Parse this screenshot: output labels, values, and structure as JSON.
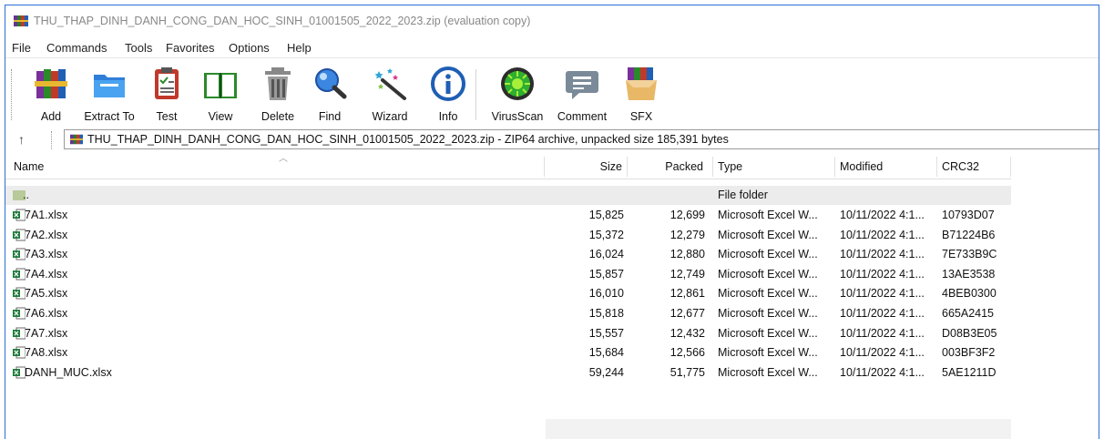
{
  "window": {
    "title": "THU_THAP_DINH_DANH_CONG_DAN_HOC_SINH_01001505_2022_2023.zip (evaluation copy)",
    "app_icon": "winrar-books-icon"
  },
  "menu": [
    "File",
    "Commands",
    "Tools",
    "Favorites",
    "Options",
    "Help"
  ],
  "toolbar": [
    {
      "label": "Add",
      "icon": "add-archive-icon"
    },
    {
      "label": "Extract To",
      "icon": "extract-folder-icon"
    },
    {
      "label": "Test",
      "icon": "test-clipboard-icon"
    },
    {
      "label": "View",
      "icon": "view-book-icon"
    },
    {
      "label": "Delete",
      "icon": "delete-trash-icon"
    },
    {
      "label": "Find",
      "icon": "find-magnifier-icon"
    },
    {
      "label": "Wizard",
      "icon": "wizard-wand-icon"
    },
    {
      "label": "Info",
      "icon": "info-icon"
    },
    {
      "label": "VirusScan",
      "icon": "virus-scan-icon"
    },
    {
      "label": "Comment",
      "icon": "comment-icon"
    },
    {
      "label": "SFX",
      "icon": "sfx-box-icon"
    }
  ],
  "address": {
    "text": "THU_THAP_DINH_DANH_CONG_DAN_HOC_SINH_01001505_2022_2023.zip - ZIP64 archive, unpacked size 185,391 bytes"
  },
  "columns": {
    "name": "Name",
    "size": "Size",
    "packed": "Packed",
    "type": "Type",
    "modified": "Modified",
    "crc": "CRC32"
  },
  "parent_row": {
    "name": "..",
    "type": "File folder"
  },
  "files": [
    {
      "name": "7A1.xlsx",
      "size": "15,825",
      "packed": "12,699",
      "type": "Microsoft Excel W...",
      "modified": "10/11/2022 4:1...",
      "crc": "10793D07"
    },
    {
      "name": "7A2.xlsx",
      "size": "15,372",
      "packed": "12,279",
      "type": "Microsoft Excel W...",
      "modified": "10/11/2022 4:1...",
      "crc": "B71224B6"
    },
    {
      "name": "7A3.xlsx",
      "size": "16,024",
      "packed": "12,880",
      "type": "Microsoft Excel W...",
      "modified": "10/11/2022 4:1...",
      "crc": "7E733B9C"
    },
    {
      "name": "7A4.xlsx",
      "size": "15,857",
      "packed": "12,749",
      "type": "Microsoft Excel W...",
      "modified": "10/11/2022 4:1...",
      "crc": "13AE3538"
    },
    {
      "name": "7A5.xlsx",
      "size": "16,010",
      "packed": "12,861",
      "type": "Microsoft Excel W...",
      "modified": "10/11/2022 4:1...",
      "crc": "4BEB0300"
    },
    {
      "name": "7A6.xlsx",
      "size": "15,818",
      "packed": "12,677",
      "type": "Microsoft Excel W...",
      "modified": "10/11/2022 4:1...",
      "crc": "665A2415"
    },
    {
      "name": "7A7.xlsx",
      "size": "15,557",
      "packed": "12,432",
      "type": "Microsoft Excel W...",
      "modified": "10/11/2022 4:1...",
      "crc": "D08B3E05"
    },
    {
      "name": "7A8.xlsx",
      "size": "15,684",
      "packed": "12,566",
      "type": "Microsoft Excel W...",
      "modified": "10/11/2022 4:1...",
      "crc": "003BF3F2"
    },
    {
      "name": "DANH_MUC.xlsx",
      "size": "59,244",
      "packed": "51,775",
      "type": "Microsoft Excel W...",
      "modified": "10/11/2022 4:1...",
      "crc": "5AE1211D"
    }
  ]
}
